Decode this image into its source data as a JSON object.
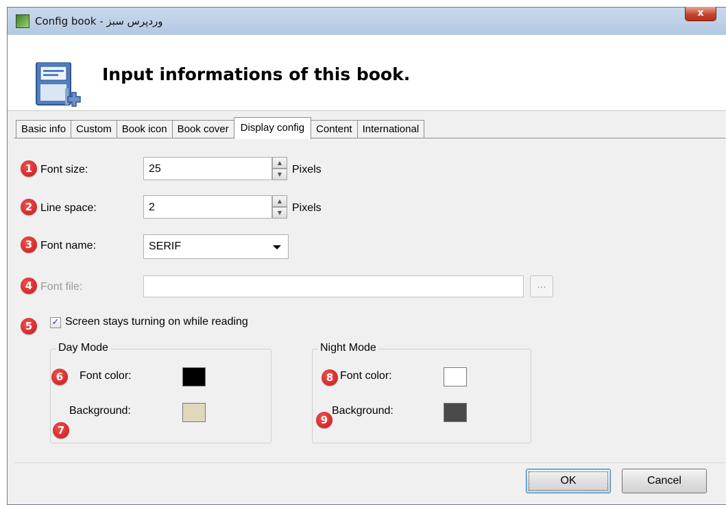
{
  "window": {
    "title": "Config book - وردپرس سبز",
    "close_label": "x"
  },
  "header": {
    "title": "Input informations of this book."
  },
  "tabs": [
    {
      "label": "Basic info"
    },
    {
      "label": "Custom"
    },
    {
      "label": "Book icon"
    },
    {
      "label": "Book cover"
    },
    {
      "label": "Display config",
      "active": true
    },
    {
      "label": "Content"
    },
    {
      "label": "International"
    }
  ],
  "badges": [
    "1",
    "2",
    "3",
    "4",
    "5",
    "6",
    "7",
    "8",
    "9"
  ],
  "display": {
    "font_size": {
      "label": "Font size:",
      "value": "25",
      "unit": "Pixels"
    },
    "line_space": {
      "label": "Line space:",
      "value": "2",
      "unit": "Pixels"
    },
    "font_name": {
      "label": "Font name:",
      "value": "SERIF"
    },
    "font_file": {
      "label": "Font file:",
      "value": "",
      "browse_label": "..."
    },
    "screen_on": {
      "label": "Screen stays turning on while reading",
      "checked": true
    },
    "day_mode": {
      "title": "Day Mode",
      "font_color_label": "Font color:",
      "font_color": "#000000",
      "background_label": "Background:",
      "background": "#e0d8bc"
    },
    "night_mode": {
      "title": "Night Mode",
      "font_color_label": "Font color:",
      "font_color": "#ffffff",
      "background_label": "Background:",
      "background": "#4a4a4a"
    }
  },
  "buttons": {
    "ok": "OK",
    "cancel": "Cancel"
  },
  "colors": {
    "badge": "#d42a2a",
    "titlebar": "#c0d4ea"
  }
}
